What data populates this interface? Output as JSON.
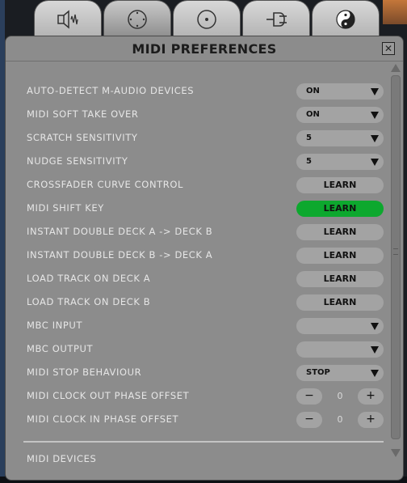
{
  "window": {
    "title": "MIDI PREFERENCES",
    "close_glyph": "✕"
  },
  "tabs": [
    {
      "name": "audio-waveform-icon",
      "active": false
    },
    {
      "name": "deck-controls-icon",
      "active": true
    },
    {
      "name": "disc-icon",
      "active": false
    },
    {
      "name": "plug-icon",
      "active": false
    },
    {
      "name": "yin-yang-icon",
      "active": false
    }
  ],
  "settings": [
    {
      "label": "AUTO-DETECT M-AUDIO DEVICES",
      "control": "dropdown",
      "value": "ON"
    },
    {
      "label": "MIDI SOFT TAKE OVER",
      "control": "dropdown",
      "value": "ON"
    },
    {
      "label": "SCRATCH SENSITIVITY",
      "control": "dropdown",
      "value": "5"
    },
    {
      "label": "NUDGE SENSITIVITY",
      "control": "dropdown",
      "value": "5"
    },
    {
      "label": "CROSSFADER CURVE CONTROL",
      "control": "learn",
      "value": "LEARN",
      "active": false
    },
    {
      "label": "MIDI SHIFT KEY",
      "control": "learn",
      "value": "LEARN",
      "active": true
    },
    {
      "label": "INSTANT DOUBLE DECK A -> DECK B",
      "control": "learn",
      "value": "LEARN",
      "active": false
    },
    {
      "label": "INSTANT DOUBLE DECK B -> DECK A",
      "control": "learn",
      "value": "LEARN",
      "active": false
    },
    {
      "label": "LOAD TRACK ON DECK A",
      "control": "learn",
      "value": "LEARN",
      "active": false
    },
    {
      "label": "LOAD TRACK ON DECK B",
      "control": "learn",
      "value": "LEARN",
      "active": false
    },
    {
      "label": "MBC INPUT",
      "control": "dropdown",
      "value": ""
    },
    {
      "label": "MBC OUTPUT",
      "control": "dropdown",
      "value": ""
    },
    {
      "label": "MIDI STOP BEHAVIOUR",
      "control": "dropdown",
      "value": "STOP"
    },
    {
      "label": "MIDI CLOCK OUT PHASE OFFSET",
      "control": "stepper",
      "value": "0",
      "minus": "−",
      "plus": "+"
    },
    {
      "label": "MIDI CLOCK IN PHASE OFFSET",
      "control": "stepper",
      "value": "0",
      "minus": "−",
      "plus": "+"
    }
  ],
  "footer": {
    "section_label": "MIDI DEVICES"
  },
  "colors": {
    "panel": "#8c8c8c",
    "control": "#a3a3a3",
    "learn_active": "#0da82e"
  }
}
